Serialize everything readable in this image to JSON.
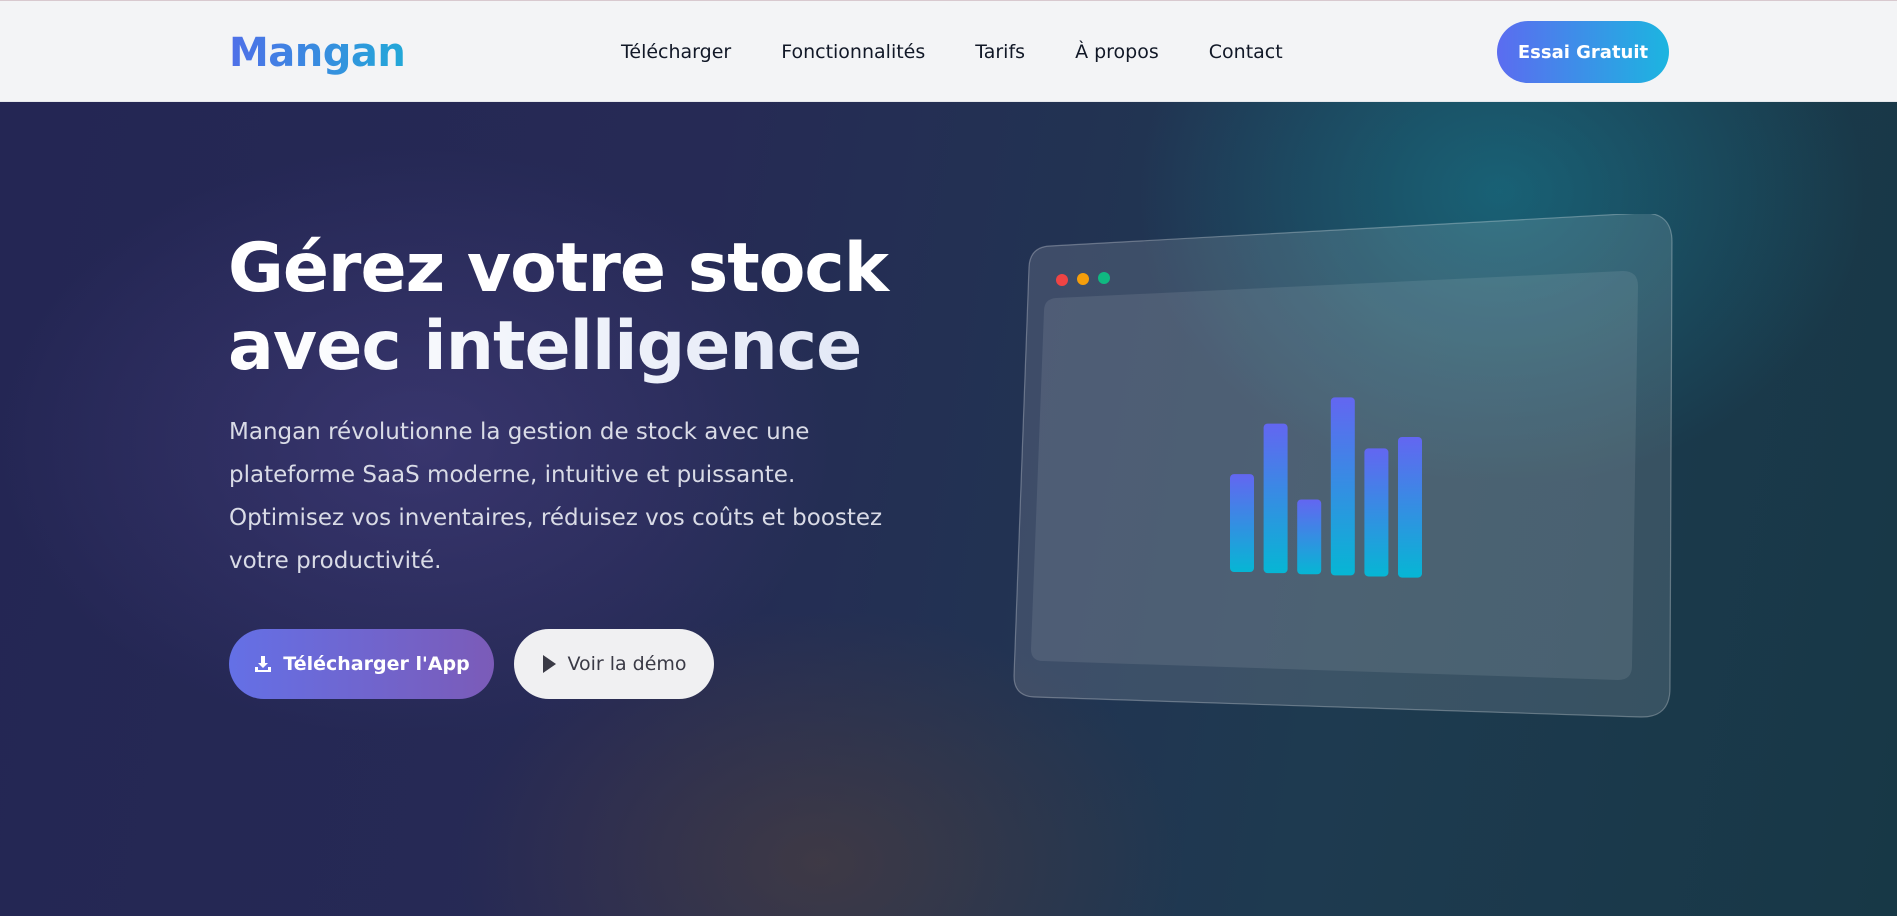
{
  "nav": {
    "logo": "Mangan",
    "links": [
      "Télécharger",
      "Fonctionnalités",
      "Tarifs",
      "À propos",
      "Contact"
    ],
    "cta": "Essai Gratuit"
  },
  "hero": {
    "title_line1": "Gérez votre stock",
    "title_line2": "avec intelligence",
    "description": "Mangan révolutionne la gestion de stock avec une plateforme SaaS moderne, intuitive et puissante. Optimisez vos inventaires, réduisez vos coûts et boostez votre productivité.",
    "download_button": "Télécharger l'App",
    "demo_button": "Voir la démo",
    "download_icon": "download-icon",
    "demo_icon": "play-icon"
  },
  "mockup": {
    "window_dots": [
      "#ef4444",
      "#f59e0b",
      "#10b981"
    ],
    "bar_levels": [
      0.55,
      0.84,
      0.42,
      1.0,
      0.72,
      0.79
    ],
    "bar_gradient": [
      "#6366f1",
      "#06b6d4"
    ]
  },
  "colors": {
    "brand_gradient": [
      "#4f6fe8",
      "#22a8d8"
    ],
    "cta_gradient": [
      "#5b6cf0",
      "#1cb5e0"
    ],
    "download_gradient": [
      "#6470e6",
      "#7b5bb8"
    ]
  }
}
